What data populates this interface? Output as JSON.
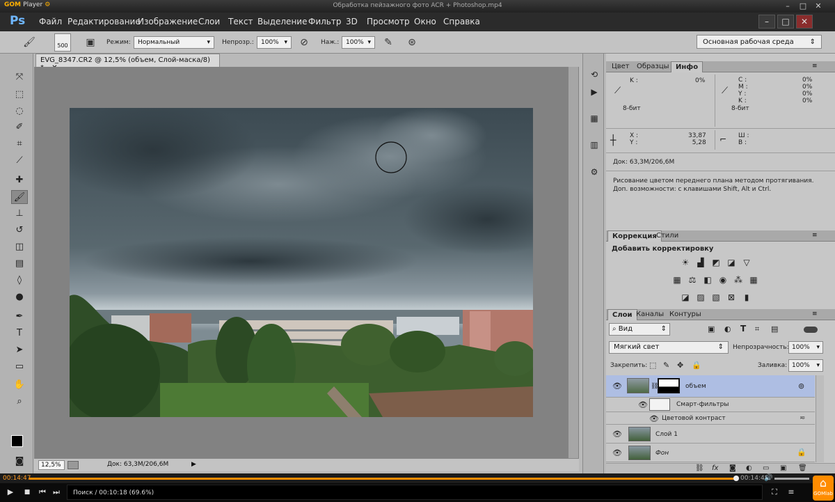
{
  "player": {
    "logo": "GOM",
    "logo_suffix": "Player",
    "file_title": "Обработка пейзажного фото ACR + Photoshop.mp4",
    "time_elapsed": "00:14:47",
    "time_total": "00:14:48",
    "progress": 0.996,
    "status": "Поиск / 00:10:18 (69.6%)",
    "lab": "GOMlab"
  },
  "photoshop": {
    "logo": "Ps",
    "menu": [
      "Файл",
      "Редактирование",
      "Изображение",
      "Слои",
      "Текст",
      "Выделение",
      "Фильтр",
      "3D",
      "Просмотр",
      "Окно",
      "Справка"
    ],
    "options": {
      "brush_size": "500",
      "mode_label": "Режим:",
      "mode_value": "Нормальный",
      "opacity_label": "Непрозр.:",
      "opacity_value": "100%",
      "pressure_label": "Наж.:",
      "pressure_value": "100%",
      "workspace": "Основная рабочая среда"
    },
    "document": {
      "tab": "EVG_8347.CR2 @ 12,5% (объем, Слой-маска/8) *",
      "zoom": "12,5%",
      "doc_size": "Док: 63,3M/206,6M"
    },
    "info_panel": {
      "tabs": [
        "Цвет",
        "Образцы",
        "Инфо"
      ],
      "k_label": "K :",
      "k_value": "0%",
      "cmyk_labels": [
        "C :",
        "M :",
        "Y :",
        "K :"
      ],
      "cmyk_values": [
        "0%",
        "0%",
        "0%",
        "0%"
      ],
      "bits_left": "8-бит",
      "bits_right": "8-бит",
      "xy_labels": [
        "X :",
        "Y :"
      ],
      "xy_values": [
        "33,87",
        "5,28"
      ],
      "wh_labels": [
        "Ш :",
        "В :"
      ],
      "doc_size": "Док: 63,3M/206,6M",
      "hint": "Рисование цветом переднего плана методом протягивания. Доп. возможности: с клавишами Shift, Alt и Ctrl."
    },
    "adjust_panel": {
      "tabs": [
        "Коррекция",
        "Стили"
      ],
      "title": "Добавить корректировку"
    },
    "layers_panel": {
      "tabs": [
        "Слои",
        "Каналы",
        "Контуры"
      ],
      "filter": "Вид",
      "blend_mode": "Мягкий свет",
      "opacity_label": "Непрозрачность:",
      "opacity_value": "100%",
      "lock_label": "Закрепить:",
      "fill_label": "Заливка:",
      "fill_value": "100%",
      "layers": [
        {
          "name": "объем"
        },
        {
          "name": "Смарт-фильтры"
        },
        {
          "name": "Цветовой контраст"
        },
        {
          "name": "Слой 1"
        },
        {
          "name": "Фон"
        }
      ]
    }
  }
}
